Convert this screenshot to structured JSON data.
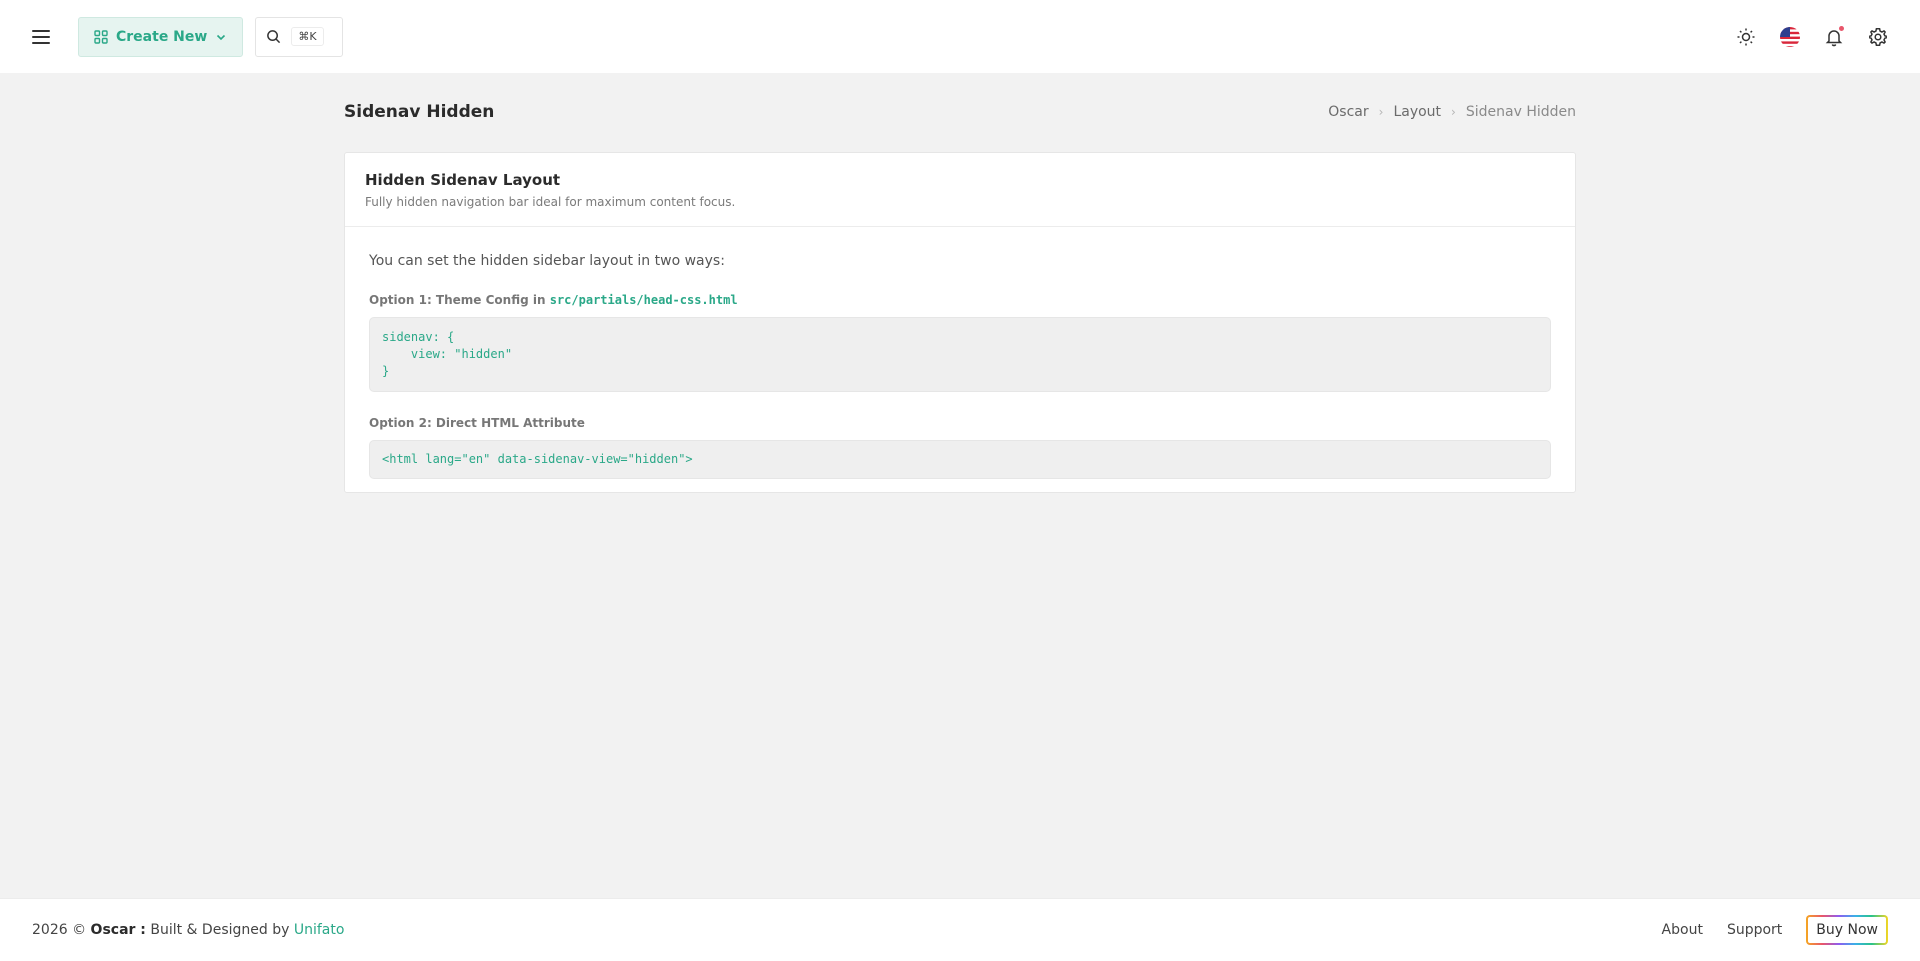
{
  "topbar": {
    "create_label": "Create New",
    "search_shortcut": "⌘K",
    "icons": [
      "menu-icon",
      "grid-icon",
      "chevron-down-icon",
      "search-icon",
      "sun-icon",
      "us-flag-icon",
      "bell-icon",
      "gear-icon"
    ]
  },
  "page": {
    "title": "Sidenav Hidden",
    "breadcrumb": [
      "Oscar",
      "Layout",
      "Sidenav Hidden"
    ]
  },
  "card": {
    "title": "Hidden Sidenav Layout",
    "subtitle": "Fully hidden navigation bar ideal for maximum content focus.",
    "intro": "You can set the hidden sidebar layout in two ways:",
    "option1_label": "Option 1: Theme Config in",
    "option1_path": "src/partials/head-css.html",
    "option1_code": "sidenav: {\n    view: \"hidden\"\n}",
    "option2_label": "Option 2: Direct HTML Attribute",
    "option2_code": "<html lang=\"en\" data-sidenav-view=\"hidden\">"
  },
  "footer": {
    "year": "2026 ©",
    "product": "Oscar :",
    "built_text": "Built & Designed by",
    "company": "Unifato",
    "links": [
      "About",
      "Support"
    ],
    "buy_label": "Buy Now"
  },
  "colors": {
    "accent": "#2aa888",
    "background": "#f2f2f2",
    "notification_dot": "#e8566b"
  }
}
